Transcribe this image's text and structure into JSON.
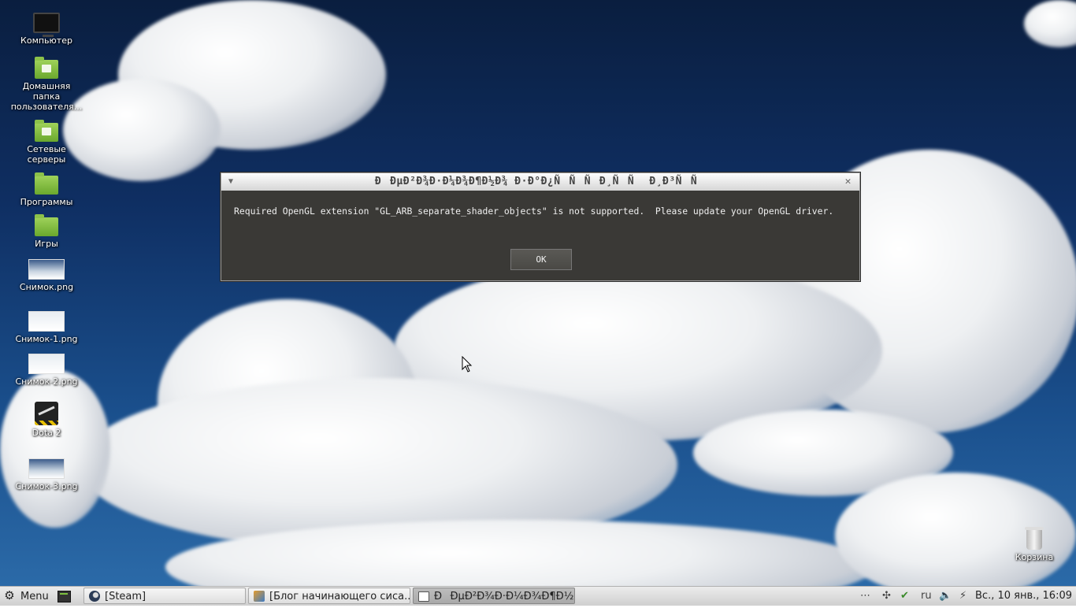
{
  "desktop": {
    "icons": [
      {
        "label": "Компьютер",
        "icon": "computer-icon"
      },
      {
        "label": "Домашняя папка пользователя...",
        "icon": "home-folder-icon"
      },
      {
        "label": "Сетевые серверы",
        "icon": "network-folder-icon"
      },
      {
        "label": "Программы",
        "icon": "folder-icon"
      },
      {
        "label": "Игры",
        "icon": "folder-icon"
      },
      {
        "label": "Снимок.png",
        "icon": "image-icon"
      },
      {
        "label": "Снимок-1.png",
        "icon": "image-icon"
      },
      {
        "label": "Снимок-2.png",
        "icon": "image-icon"
      },
      {
        "label": "Dota 2",
        "icon": "steam-game-icon"
      },
      {
        "label": "Снимок-3.png",
        "icon": "image-icon"
      }
    ],
    "trash": {
      "label": "Корзина",
      "icon": "trash-icon"
    }
  },
  "dialog": {
    "title": "ÐÐµÐ²Ð¾Ð·Ð¼Ð¾Ð¶Ð½Ð¾ Ð·Ð°Ð¿ÑÑÑÐ¸ÑÑ Ð¸Ð³ÑÑ",
    "menu_glyph": "▼",
    "close_glyph": "✕",
    "message": "Required OpenGL extension \"GL_ARB_separate_shader_objects\" is not supported.  Please update your OpenGL driver.",
    "ok_label": "OK"
  },
  "taskbar": {
    "menu_label": "Menu",
    "windows": [
      {
        "label": "[Steam]",
        "active": false
      },
      {
        "label": "[Блог начинающего сиса...",
        "active": false
      },
      {
        "label": "ÐÐµÐ²Ð¾Ð·Ð¼Ð¾Ð¶Ð½...",
        "active": true
      }
    ],
    "keyboard_layout": "ru",
    "clock": "Вс., 10 янв., 16:09"
  }
}
